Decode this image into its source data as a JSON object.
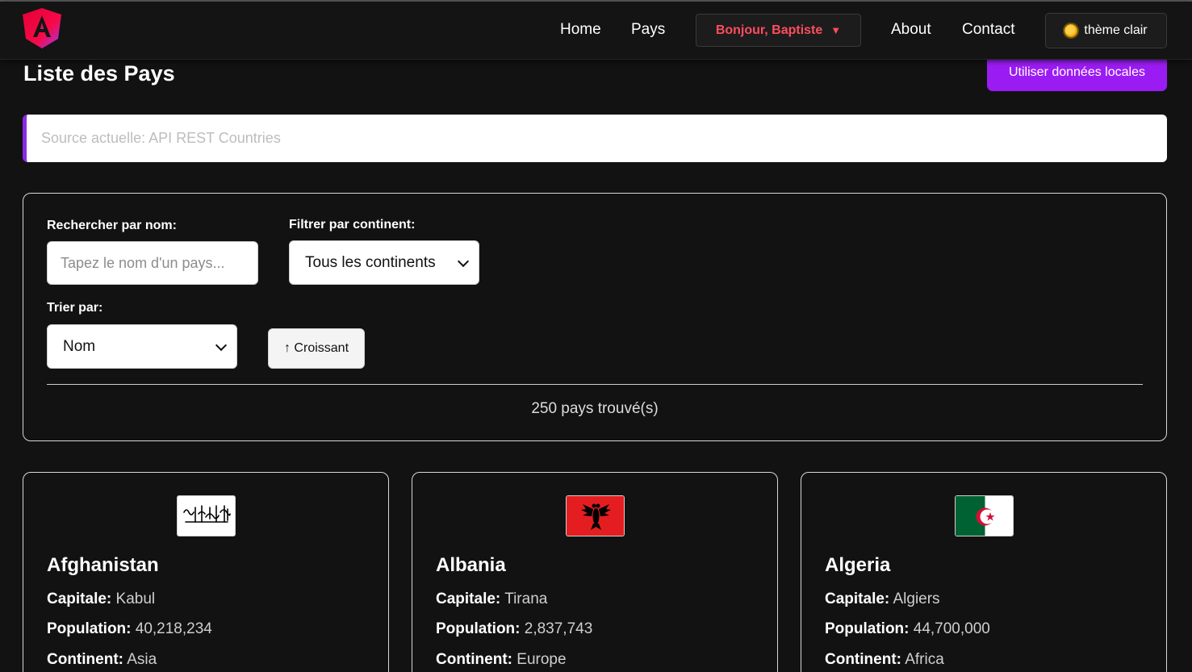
{
  "nav": {
    "links": [
      "Home",
      "Pays",
      "About",
      "Contact"
    ],
    "user_greeting": "Bonjour, Baptiste",
    "user_caret": "▼",
    "theme_label": "thème clair"
  },
  "header": {
    "title": "Liste des Pays",
    "local_data_button": "Utiliser données locales"
  },
  "source": {
    "text": "Source actuelle: API REST Countries"
  },
  "filters": {
    "search_label": "Rechercher par nom:",
    "search_placeholder": "Tapez le nom d'un pays...",
    "search_value": "",
    "continent_label": "Filtrer par continent:",
    "continent_selected": "Tous les continents",
    "sort_label": "Trier par:",
    "sort_selected": "Nom",
    "order_button": "↑ Croissant",
    "result_count": "250 pays trouvé(s)"
  },
  "card_labels": {
    "capital": "Capitale:",
    "population": "Population:",
    "continent": "Continent:"
  },
  "countries": [
    {
      "name": "Afghanistan",
      "capital": "Kabul",
      "population": "40,218,234",
      "continent": "Asia"
    },
    {
      "name": "Albania",
      "capital": "Tirana",
      "population": "2,837,743",
      "continent": "Europe"
    },
    {
      "name": "Algeria",
      "capital": "Algiers",
      "population": "44,700,000",
      "continent": "Africa"
    }
  ],
  "colors": {
    "background": "#121212",
    "accent_purple": "#9b1cf2",
    "user_red": "#ff4d5e",
    "albania_red": "#e41e20",
    "algeria_green": "#006233",
    "algeria_red": "#d21034"
  },
  "icons": {
    "logo": "angular-logo",
    "theme": "sun-icon",
    "flags": [
      "afghanistan-flag",
      "albania-flag",
      "algeria-flag"
    ]
  }
}
